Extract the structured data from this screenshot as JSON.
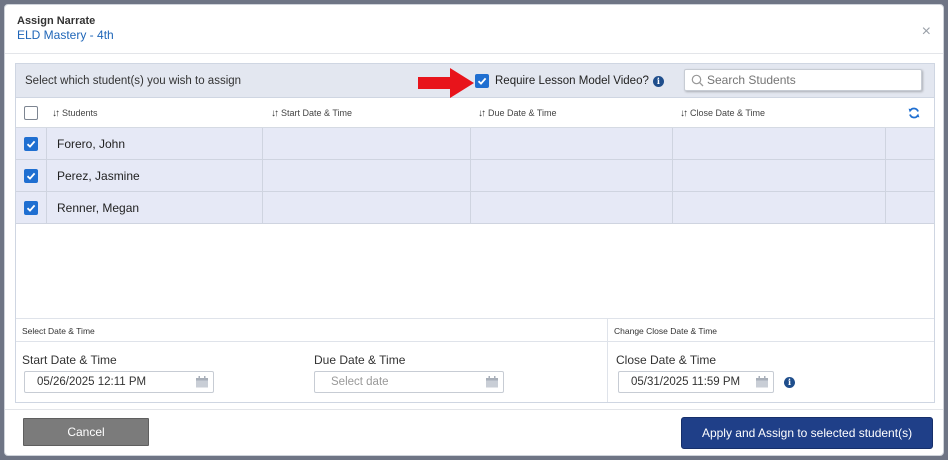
{
  "modal": {
    "title": "Assign Narrate",
    "subtitle": "ELD Mastery - 4th",
    "close": "×"
  },
  "panel": {
    "heading": "Select which student(s) you wish to assign",
    "require_video_label": "Require Lesson Model Video?",
    "require_video_checked": true,
    "search_placeholder": "Search Students"
  },
  "table": {
    "columns": [
      "Students",
      "Start Date & Time",
      "Due Date & Time",
      "Close Date & Time"
    ],
    "rows": [
      {
        "name": "Forero, John",
        "checked": true
      },
      {
        "name": "Perez, Jasmine",
        "checked": true
      },
      {
        "name": "Renner, Megan",
        "checked": true
      }
    ]
  },
  "dates": {
    "select_heading": "Select Date & Time",
    "change_close_heading": "Change Close Date & Time",
    "start_label": "Start Date & Time",
    "start_value": "05/26/2025 12:11 PM",
    "due_label": "Due Date & Time",
    "due_placeholder": "Select date",
    "close_label": "Close Date & Time",
    "close_value": "05/31/2025 11:59 PM"
  },
  "footer": {
    "cancel_label": "Cancel",
    "apply_label": "Apply and Assign to selected student(s)"
  },
  "colors": {
    "accent": "#1f6fd1",
    "primary_button": "#1f3f88",
    "arrow": "#e8141b"
  }
}
